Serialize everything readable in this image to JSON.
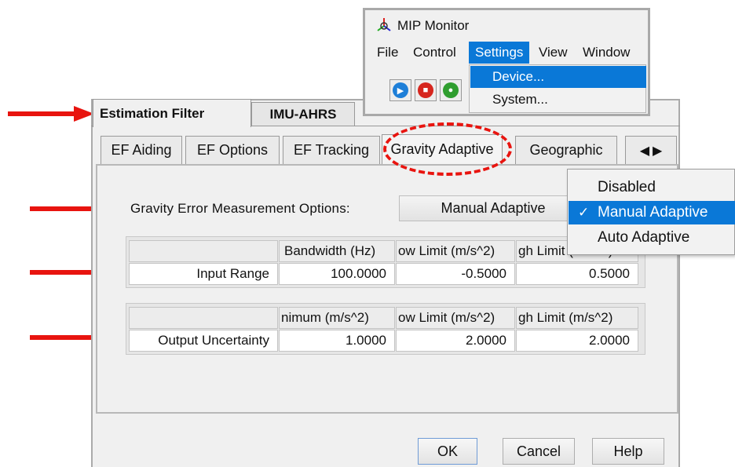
{
  "colors": {
    "accent": "#0a78d7",
    "annotation": "#e8140f"
  },
  "mip_window": {
    "title": "MIP Monitor",
    "menu": [
      "File",
      "Control",
      "Settings",
      "View",
      "Window"
    ],
    "settings_menu": [
      "Device...",
      "System..."
    ],
    "toolbar_icons": [
      "play-icon",
      "stop-icon",
      "record-icon"
    ]
  },
  "main_tabs": [
    "Estimation Filter",
    "IMU-AHRS"
  ],
  "sub_tabs": [
    "EF Aiding",
    "EF Options",
    "EF Tracking",
    "Gravity Adaptive",
    "Geographic"
  ],
  "gravity": {
    "label": "Gravity Error Measurement Options:",
    "selected": "Manual Adaptive",
    "options": [
      "Disabled",
      "Manual Adaptive",
      "Auto Adaptive"
    ],
    "check": "✓"
  },
  "input_table": {
    "headers": [
      "Bandwidth (Hz)",
      "ow Limit (m/s^2)",
      "gh Limit (m/s^2)"
    ],
    "row_label": "Input Range",
    "values": [
      "100.0000",
      "-0.5000",
      "0.5000"
    ]
  },
  "output_table": {
    "headers": [
      "nimum (m/s^2)",
      "ow Limit (m/s^2)",
      "gh Limit (m/s^2)"
    ],
    "row_label": "Output Uncertainty",
    "values": [
      "1.0000",
      "2.0000",
      "2.0000"
    ]
  },
  "buttons": {
    "ok": "OK",
    "cancel": "Cancel",
    "help": "Help"
  }
}
